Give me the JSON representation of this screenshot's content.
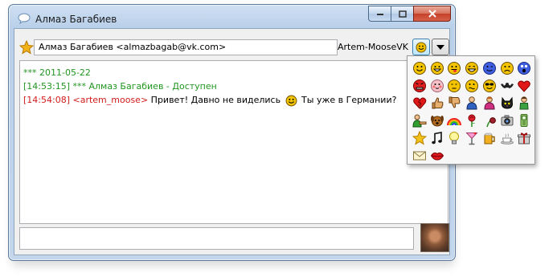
{
  "window": {
    "title": "Алмаз Багабиев"
  },
  "toolbar": {
    "contact": "Алмаз Багабиев <almazbagab@vk.com>",
    "account": "Artem-MooseVK"
  },
  "log": {
    "date": "*** 2011-05-22",
    "status_time": "[14:53:15]",
    "status_text": "*** Алмаз Багабиев - Доступен",
    "msg_time": "[14:54:08]",
    "msg_nick": "<artem_moose>",
    "msg_text_1": "Привет! Давно не виделись",
    "msg_text_2": "Ты уже в Германии?"
  },
  "emoticons": [
    "smile-icon",
    "grin-icon",
    "tongue-icon",
    "laugh-icon",
    "wink-icon",
    "sad-icon",
    "surprised-icon",
    "angry-icon",
    "blush-icon",
    "pensive-icon",
    "confused-icon",
    "cool-icon",
    "bat-icon",
    "heart-icon",
    "broken-heart-icon",
    "thumbs-up-icon",
    "thumbs-down-icon",
    "man-icon",
    "woman-icon",
    "cat-icon",
    "boy-icon",
    "hug-left-icon",
    "dog-icon",
    "rainbow-icon",
    "rose-icon",
    "wilted-rose-icon",
    "camera-icon",
    "cellphone-icon",
    "star-icon",
    "music-note-icon",
    "lightbulb-icon",
    "cocktail-icon",
    "beer-icon",
    "coffee-icon",
    "gift-icon",
    "mail-icon",
    "lips-icon"
  ],
  "colors": {
    "status_green": "#229622",
    "message_red": "#d21c1c",
    "smiley_yellow": "#f4c400"
  }
}
